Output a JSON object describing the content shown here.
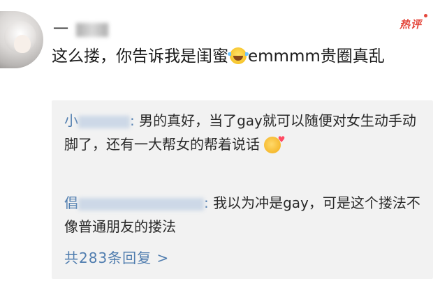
{
  "comment": {
    "username": "一",
    "badge": "热评",
    "text_part1": "这么搂，你告诉我是闺蜜",
    "text_part2": "emmmm贵圈真乱",
    "emoji_inline": "laughing-tears-emoji"
  },
  "replies": [
    {
      "name_visible": "小",
      "name_suffix": ":",
      "text": "男的真好，当了gay就可以随便对女生动手动脚了，还有一大帮女的帮着说话",
      "emoji": "blowing-kiss-emoji"
    },
    {
      "name_visible": "倡",
      "name_suffix": ":",
      "text": "我以为冲是gay，可是这个搂法不像普通朋友的搂法"
    }
  ],
  "more_replies_label": "共283条回复 >",
  "colors": {
    "link": "#507daf",
    "hot": "#e4463b",
    "reply_bg": "#f2f2f2"
  }
}
